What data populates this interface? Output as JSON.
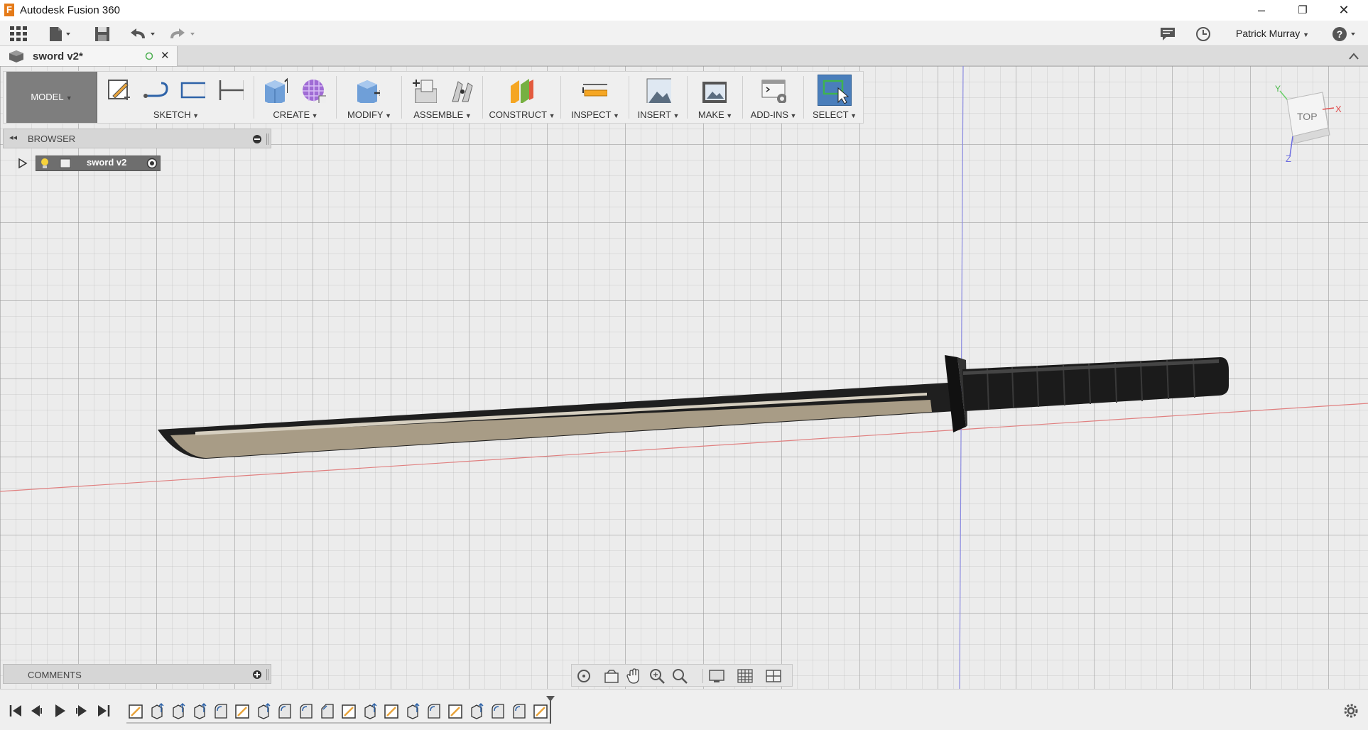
{
  "app": {
    "title": "Autodesk Fusion 360",
    "logo_letter": "F"
  },
  "window_controls": {
    "minimize": "–",
    "restore": "❐",
    "close": "✕"
  },
  "quick_access": {
    "user_name": "Patrick Murray",
    "help": "?"
  },
  "document_tab": {
    "name": "sword v2*",
    "close": "✕"
  },
  "workspace": {
    "label": "MODEL"
  },
  "toolbar_groups": [
    {
      "id": "sketch",
      "label": "SKETCH"
    },
    {
      "id": "create",
      "label": "CREATE"
    },
    {
      "id": "modify",
      "label": "MODIFY"
    },
    {
      "id": "assemble",
      "label": "ASSEMBLE"
    },
    {
      "id": "construct",
      "label": "CONSTRUCT"
    },
    {
      "id": "inspect",
      "label": "INSPECT"
    },
    {
      "id": "insert",
      "label": "INSERT"
    },
    {
      "id": "make",
      "label": "MAKE"
    },
    {
      "id": "addins",
      "label": "ADD-INS"
    },
    {
      "id": "select",
      "label": "SELECT"
    }
  ],
  "browser": {
    "label": "BROWSER",
    "root_node": "sword v2"
  },
  "comments": {
    "label": "COMMENTS"
  },
  "viewcube": {
    "face": "TOP",
    "axis_x": "X",
    "axis_y": "Y",
    "axis_z": "Z"
  },
  "colors": {
    "accent_select": "#4a7ebb",
    "blade_dark": "#1f1f1f",
    "blade_edge": "#a89c86",
    "axis_red": "#e06060",
    "axis_blue": "#7b7bd6",
    "workspace_bg": "#7e7e7e"
  }
}
